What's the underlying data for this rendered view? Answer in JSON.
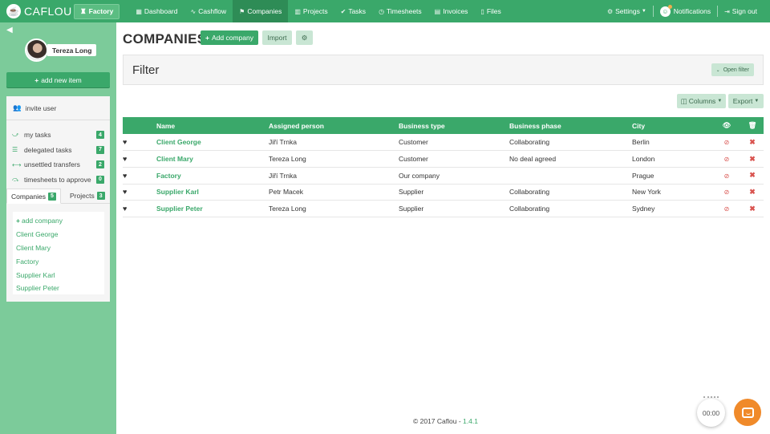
{
  "nav": {
    "logo_text": "CAFLOU",
    "factory_label": "Factory",
    "items": [
      {
        "label": "Dashboard",
        "icon": "dashboard-icon",
        "glyph": "▦"
      },
      {
        "label": "Cashflow",
        "icon": "cashflow-icon",
        "glyph": "∿"
      },
      {
        "label": "Companies",
        "icon": "companies-icon",
        "glyph": "⚑"
      },
      {
        "label": "Projects",
        "icon": "projects-icon",
        "glyph": "▥"
      },
      {
        "label": "Tasks",
        "icon": "tasks-icon",
        "glyph": "✔"
      },
      {
        "label": "Timesheets",
        "icon": "timesheets-icon",
        "glyph": "◷"
      },
      {
        "label": "Invoices",
        "icon": "invoices-icon",
        "glyph": "▤"
      },
      {
        "label": "Files",
        "icon": "files-icon",
        "glyph": "▯"
      }
    ],
    "settings_label": "Settings",
    "notifications_label": "Notifications",
    "signout_label": "Sign out"
  },
  "sidebar": {
    "user_name": "Tereza Long",
    "add_item_label": "add new item",
    "invite_label": "invite user",
    "stats": [
      {
        "label": "my tasks",
        "count": "4",
        "icon": "my-tasks-icon",
        "glyph": "⤻"
      },
      {
        "label": "delegated tasks",
        "count": "7",
        "icon": "delegated-tasks-icon",
        "glyph": "☰"
      },
      {
        "label": "unsettled transfers",
        "count": "2",
        "icon": "transfers-icon",
        "glyph": "⟷"
      },
      {
        "label": "timesheets to approve",
        "count": "0",
        "icon": "timesheets-approve-icon",
        "glyph": "⤼"
      }
    ],
    "tabs": [
      {
        "label": "Companies",
        "count": "5"
      },
      {
        "label": "Projects",
        "count": "3"
      }
    ],
    "add_company_label": "add company",
    "companies": [
      "Client George",
      "Client Mary",
      "Factory",
      "Supplier Karl",
      "Supplier Peter"
    ]
  },
  "main": {
    "title": "COMPANIES",
    "add_company_label": "Add company",
    "import_label": "Import",
    "filter_title": "Filter",
    "open_filter_label": "Open filter",
    "columns_label": "Columns",
    "export_label": "Export",
    "table": {
      "headers": [
        "Name",
        "Assigned person",
        "Business type",
        "Business phase",
        "City"
      ],
      "rows": [
        [
          "Client George",
          "Jiří Trnka",
          "Customer",
          "Collaborating",
          "Berlin"
        ],
        [
          "Client Mary",
          "Tereza Long",
          "Customer",
          "No deal agreed",
          "London"
        ],
        [
          "Factory",
          "Jiří Trnka",
          "Our company",
          "",
          "Prague"
        ],
        [
          "Supplier Karl",
          "Petr Macek",
          "Supplier",
          "Collaborating",
          "New York"
        ],
        [
          "Supplier Peter",
          "Tereza Long",
          "Supplier",
          "Collaborating",
          "Sydney"
        ]
      ]
    }
  },
  "footer": {
    "copyright": "© 2017 Caflou - ",
    "version": "1.4.1"
  },
  "timer": "00:00",
  "colors": {
    "primary": "#3aa86a",
    "sidebar": "#7ccb9a",
    "danger": "#d9534f",
    "chat": "#f08a2a"
  }
}
